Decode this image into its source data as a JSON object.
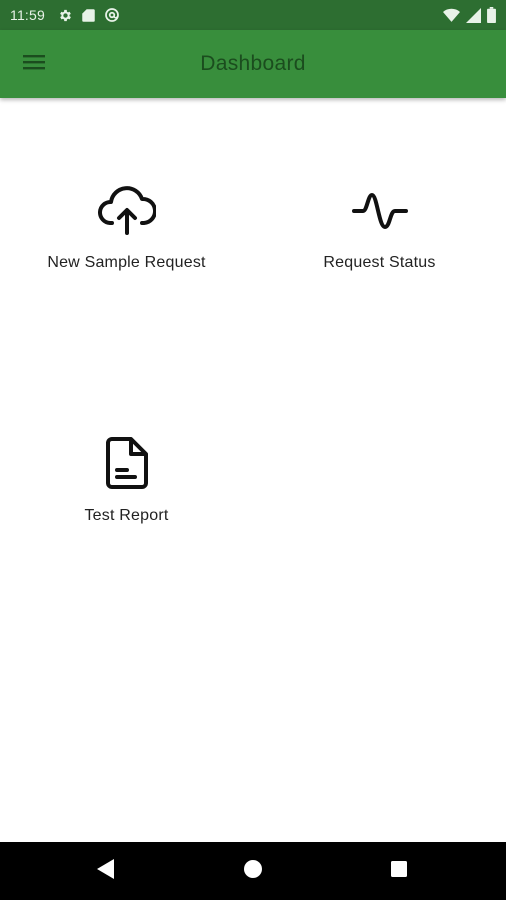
{
  "status_bar": {
    "time": "11:59",
    "left_icons": [
      "gear-icon",
      "sd-card-icon",
      "at-sign-icon"
    ],
    "right_icons": [
      "wifi-icon",
      "cell-signal-icon",
      "battery-icon"
    ]
  },
  "app_bar": {
    "title": "Dashboard",
    "menu_icon": "hamburger-menu-icon",
    "background": "#388e3c",
    "title_color": "#1b4d1e"
  },
  "tiles": [
    {
      "label": "New Sample Request",
      "icon": "cloud-upload-icon"
    },
    {
      "label": "Request Status",
      "icon": "activity-icon"
    },
    {
      "label": "Test Report",
      "icon": "document-icon"
    }
  ],
  "nav_bar": {
    "buttons": [
      "back-icon",
      "home-icon",
      "recents-icon"
    ]
  },
  "colors": {
    "status_bar": "#2d6e31",
    "app_bar": "#388e3c",
    "background": "#ffffff",
    "text": "#222222"
  }
}
